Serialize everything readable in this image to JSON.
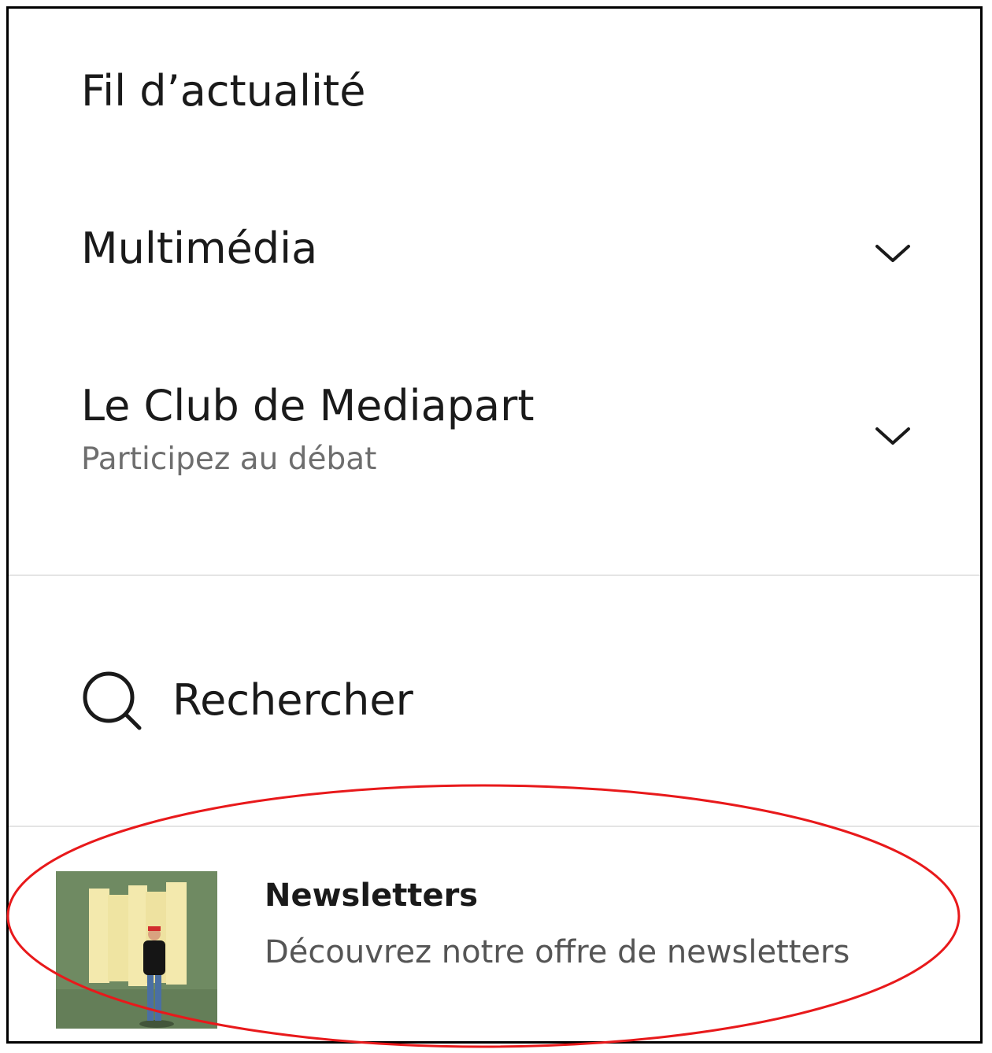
{
  "menu": {
    "items": [
      {
        "label": "Fil d’actualité"
      },
      {
        "label": "Multimédia"
      },
      {
        "label": "Le Club de Mediapart",
        "subtitle": "Participez au débat"
      }
    ],
    "search": {
      "label": "Rechercher",
      "icon": "search-icon"
    },
    "newsletters": {
      "title": "Newsletters",
      "description": "Découvrez notre offre de newsletters",
      "image": "newsletters-illustration"
    }
  },
  "annotation": {
    "shape": "ellipse",
    "color": "#e8191b"
  }
}
